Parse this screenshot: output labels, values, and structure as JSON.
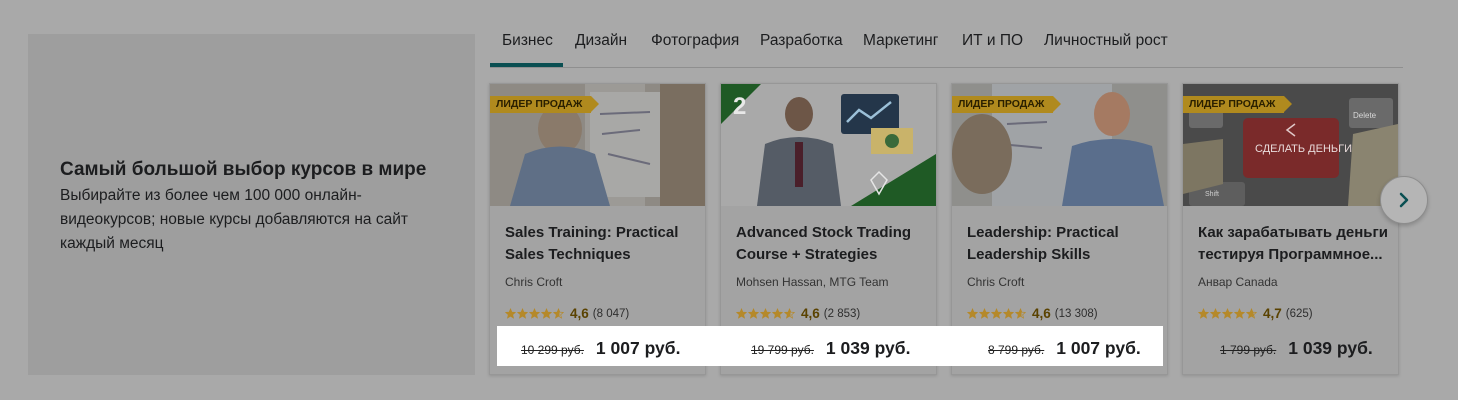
{
  "promo": {
    "title": "Самый большой выбор курсов в мире",
    "text": "Выбирайте из более чем 100 000 онлайн-видеокурсов; новые курсы добавляются на сайт каждый месяц"
  },
  "tabs": [
    {
      "label": "Бизнес",
      "active": true
    },
    {
      "label": "Дизайн"
    },
    {
      "label": "Фотография"
    },
    {
      "label": "Разработка"
    },
    {
      "label": "Маркетинг"
    },
    {
      "label": "ИТ и ПО"
    },
    {
      "label": "Личностный рост"
    }
  ],
  "cards": [
    {
      "badge": "ЛИДЕР ПРОДАЖ",
      "title": "Sales Training: Practical Sales Techniques",
      "author": "Chris Croft",
      "rating": "4,6",
      "rating_value": 4.6,
      "reviews": "(8 047)",
      "old_price": "10 299 руб.",
      "price": "1 007 руб."
    },
    {
      "badge": "",
      "thumb_number": "2",
      "title": "Advanced Stock Trading Course + Strategies",
      "author": "Mohsen Hassan, MTG Team",
      "rating": "4,6",
      "rating_value": 4.6,
      "reviews": "(2 853)",
      "old_price": "19 799 руб.",
      "price": "1 039 руб."
    },
    {
      "badge": "ЛИДЕР ПРОДАЖ",
      "title": "Leadership: Practical Leadership Skills",
      "author": "Chris Croft",
      "rating": "4,6",
      "rating_value": 4.6,
      "reviews": "(13 308)",
      "old_price": "8 799 руб.",
      "price": "1 007 руб."
    },
    {
      "badge": "ЛИДЕР ПРОДАЖ",
      "thumb_keys": [
        "Delete",
        "СДЕЛАТЬ ДЕНЬГИ",
        "Shift"
      ],
      "title": "Как зарабатывать деньги тестируя Программное...",
      "author": "Анвар Canada",
      "rating": "4,7",
      "rating_value": 4.7,
      "reviews": "(625)",
      "old_price": "1 799 руб.",
      "price": "1 039 руб."
    }
  ],
  "icons": {
    "next": "chevron-right-icon",
    "star": "star-icon"
  },
  "colors": {
    "accent": "#0a4f52",
    "star": "#b5892a",
    "badge": "#b08a1e"
  }
}
